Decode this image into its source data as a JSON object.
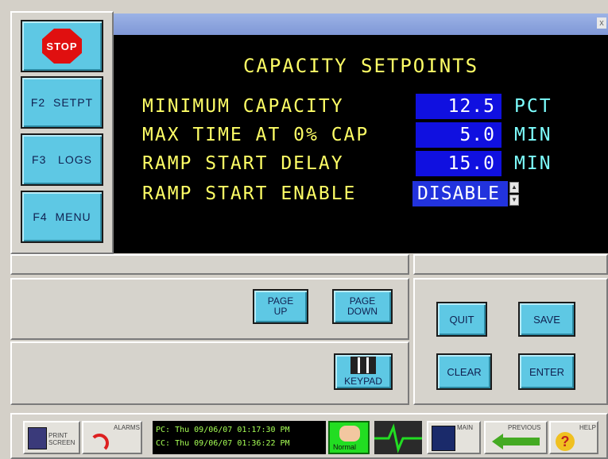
{
  "window": {
    "title": "",
    "close_glyph": "x"
  },
  "sidebar": {
    "items": [
      {
        "label": "STOP",
        "icon": "stop-sign-icon"
      },
      {
        "label": "F2  SETPT"
      },
      {
        "label": "F3   LOGS"
      },
      {
        "label": "F4  MENU"
      }
    ]
  },
  "dialog": {
    "heading": "CAPACITY SETPOINTS",
    "rows": [
      {
        "label": "MINIMUM CAPACITY",
        "value": "12.5",
        "unit": "PCT"
      },
      {
        "label": "MAX TIME AT 0% CAP",
        "value": "5.0",
        "unit": "MIN"
      },
      {
        "label": "RAMP START DELAY",
        "value": "15.0",
        "unit": "MIN"
      },
      {
        "label": "RAMP START ENABLE",
        "value": "DISABLE",
        "unit": ""
      }
    ],
    "spinner_up": "▲",
    "spinner_down": "▼"
  },
  "buttons": {
    "page_up": "PAGE\nUP",
    "page_down": "PAGE\nDOWN",
    "keypad": "KEYPAD",
    "quit": "QUIT",
    "save": "SAVE",
    "clear": "CLEAR",
    "enter": "ENTER"
  },
  "taskbar": {
    "print_screen": "PRINT\nSCREEN",
    "alarms": "ALARMS",
    "pc_time": "PC: Thu 09/06/07 01:17:30 PM",
    "cc_time": "CC: Thu 09/06/07 01:36:22 PM",
    "status": "Normal",
    "main": "MAIN",
    "previous": "PREVIOUS",
    "help": "HELP"
  },
  "colors": {
    "panel": "#d6d3cc",
    "button": "#5ec8e4",
    "label": "#ffff66",
    "value_bg": "#1010e0",
    "unit": "#7dffff",
    "status_green": "#22dd22"
  }
}
